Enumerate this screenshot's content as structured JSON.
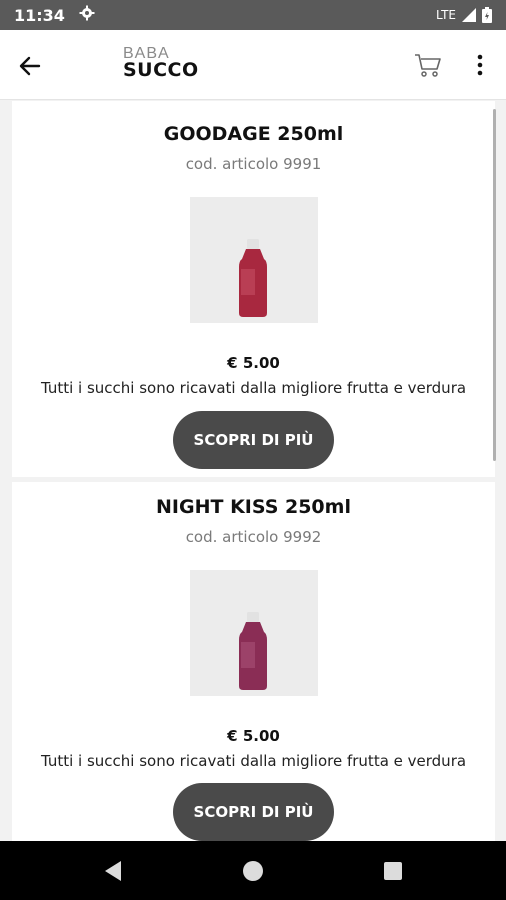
{
  "status_bar": {
    "time": "11:34",
    "network": "LTE"
  },
  "app_bar": {
    "logo_top": "BABA",
    "logo_bottom": "SUCCO"
  },
  "products": [
    {
      "title": "GOODAGE 250ml",
      "code": "cod. articolo 9991",
      "price": "€ 5.00",
      "description": "Tutti i succhi sono ricavati dalla migliore frutta e verdura",
      "cta": "SCOPRI DI PIÙ",
      "bottle_color": "#a8283f"
    },
    {
      "title": "NIGHT KISS 250ml",
      "code": "cod. articolo 9992",
      "price": "€ 5.00",
      "description": "Tutti i succhi sono ricavati dalla migliore frutta e verdura",
      "cta": "SCOPRI DI PIÙ",
      "bottle_color": "#8a2d55"
    }
  ],
  "icons": {
    "back": "arrow-left-icon",
    "cart": "cart-icon",
    "more": "more-vertical-icon",
    "settings": "gear-icon"
  },
  "colors": {
    "status_bar": "#5a5a5a",
    "cta_bg": "#4a4a4a",
    "nav_bar": "#000000"
  }
}
